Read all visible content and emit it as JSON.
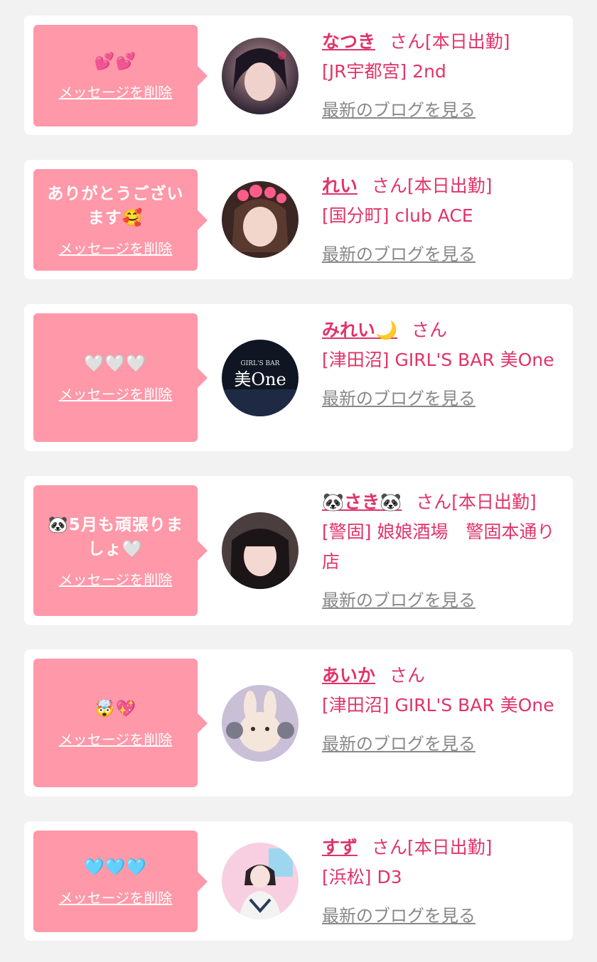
{
  "delete_label": "メッセージを削除",
  "blog_label": "最新のブログを見る",
  "honorific": "さん",
  "entries": [
    {
      "message": "💕💕",
      "name": "なつき",
      "status": "[本日出勤]",
      "location": "[JR宇都宮] 2nd"
    },
    {
      "message": "ありがとうございます🥰",
      "name": "れい",
      "status": "[本日出勤]",
      "location": "[国分町] club ACE"
    },
    {
      "message": "🤍🤍🤍",
      "name": "みれい🌙",
      "status": "",
      "location": "[津田沼] GIRL'S BAR 美One"
    },
    {
      "message": "🐼5月も頑張りましょ🤍",
      "name": "🐼さき🐼",
      "status": "[本日出勤]",
      "location": "[警固] 娘娘酒場　警固本通り店"
    },
    {
      "message": "🤯💖",
      "name": "あいか",
      "status": "",
      "location": "[津田沼] GIRL'S BAR 美One"
    },
    {
      "message": "🩵🩵🩵",
      "name": "すず",
      "status": "[本日出勤]",
      "location": "[浜松] D3"
    }
  ],
  "avatar_logo": {
    "small_text": "GIRL'S BAR",
    "big_text": "美One"
  },
  "colors": {
    "accent": "#e0336a",
    "bubble": "#ff98a8",
    "link_gray": "#888888",
    "background": "#f2f2f2"
  }
}
